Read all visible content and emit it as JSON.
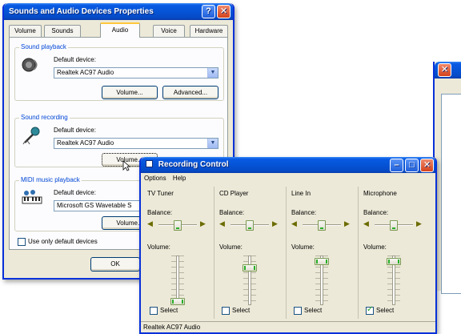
{
  "properties_window": {
    "title": "Sounds and Audio Devices Properties",
    "help_glyph": "?",
    "close_glyph": "✕",
    "tabs": [
      {
        "label": "Volume"
      },
      {
        "label": "Sounds"
      },
      {
        "label": "Audio"
      },
      {
        "label": "Voice"
      },
      {
        "label": "Hardware"
      }
    ],
    "active_tab": "Audio",
    "playback": {
      "group_label": "Sound playback",
      "default_label": "Default device:",
      "device": "Realtek AC97 Audio",
      "volume_button": "Volume...",
      "advanced_button": "Advanced..."
    },
    "recording": {
      "group_label": "Sound recording",
      "default_label": "Default device:",
      "device": "Realtek AC97 Audio",
      "volume_button": "Volume..."
    },
    "midi": {
      "group_label": "MIDI music playback",
      "default_label": "Default device:",
      "device": "Microsoft GS Wavetable S",
      "volume_button": "Volume..."
    },
    "use_default_label": "Use only default devices",
    "use_default_checked": false,
    "ok_button": "OK"
  },
  "recording_control": {
    "title": "Recording Control",
    "menu": [
      "Options",
      "Help"
    ],
    "window_buttons": {
      "minimize": "–",
      "maximize": "□",
      "close": "✕"
    },
    "channels": [
      {
        "name": "TV Tuner",
        "balance_label": "Balance:",
        "volume_label": "Volume:",
        "balance": 0.5,
        "volume": 0.0,
        "select_label": "Select",
        "selected": false
      },
      {
        "name": "CD Player",
        "balance_label": "Balance:",
        "volume_label": "Volume:",
        "balance": 0.5,
        "volume": 0.8,
        "select_label": "Select",
        "selected": false
      },
      {
        "name": "Line In",
        "balance_label": "Balance:",
        "volume_label": "Volume:",
        "balance": 0.5,
        "volume": 0.95,
        "select_label": "Select",
        "selected": false
      },
      {
        "name": "Microphone",
        "balance_label": "Balance:",
        "volume_label": "Volume:",
        "balance": 0.5,
        "volume": 0.95,
        "select_label": "Select",
        "selected": true
      }
    ],
    "status": "Realtek AC97 Audio"
  },
  "background_window": {
    "close_glyph": "✕"
  },
  "colors": {
    "title_blue": "#0554d6",
    "window_face": "#ece9d8",
    "group_label": "#0046d5",
    "close_red": "#d3421b",
    "check_green": "#21a121"
  }
}
